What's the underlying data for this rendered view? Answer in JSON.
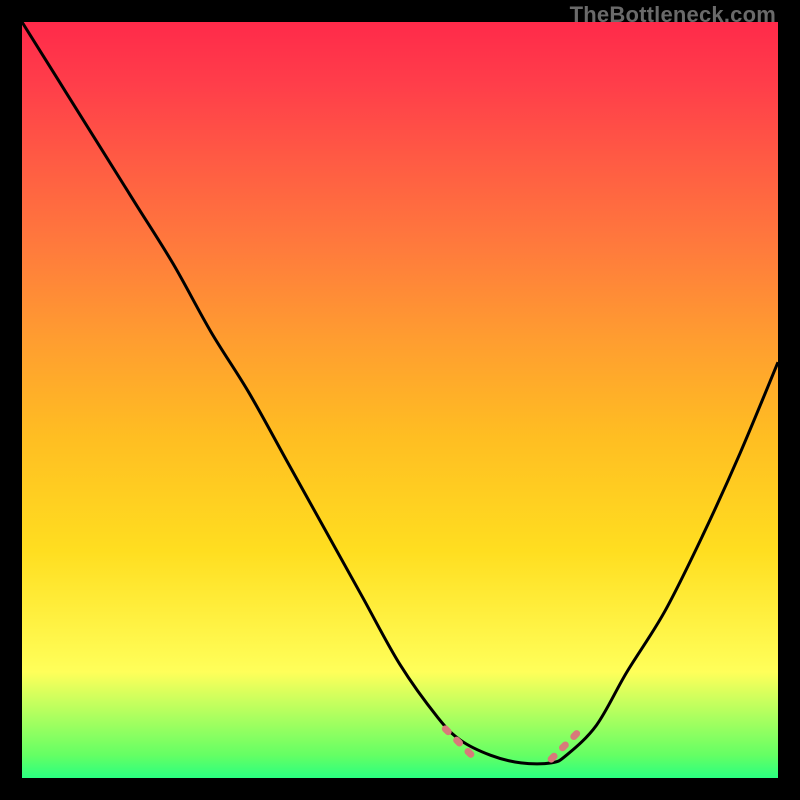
{
  "attribution": "TheBottleneck.com",
  "colors": {
    "background": "#000000",
    "curve_stroke": "#000000",
    "dash_stroke": "#d87a7a",
    "gradient_top": "#ff2a4a",
    "gradient_bottom": "#2aff80"
  },
  "chart_data": {
    "type": "line",
    "title": "",
    "xlabel": "",
    "ylabel": "",
    "xlim": [
      0,
      100
    ],
    "ylim": [
      0,
      100
    ],
    "series": [
      {
        "name": "bottleneck-curve",
        "x": [
          0,
          5,
          10,
          15,
          20,
          25,
          30,
          35,
          40,
          45,
          50,
          55,
          58,
          62,
          66,
          70,
          72,
          76,
          80,
          85,
          90,
          95,
          100
        ],
        "y": [
          100,
          92,
          84,
          76,
          68,
          59,
          51,
          42,
          33,
          24,
          15,
          8,
          5,
          3,
          2,
          2,
          3,
          7,
          14,
          22,
          32,
          43,
          55
        ]
      }
    ],
    "flat_region": {
      "x_start": 58,
      "x_end": 72,
      "y": 2.5
    },
    "annotations": []
  }
}
